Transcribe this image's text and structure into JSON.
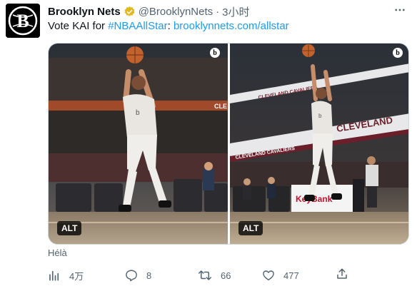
{
  "account": {
    "avatar_letter": "B",
    "display_name": "Brooklyn Nets",
    "handle": "@BrooklynNets",
    "separator": "·",
    "time": "3小时"
  },
  "tweet": {
    "text_prefix": "Vote KAI for ",
    "hashtag": "#NBAAllStar",
    "colon": ": ",
    "link": "brooklynnets.com/allstar"
  },
  "media": {
    "photos": [
      {
        "alt_label": "ALT",
        "logo": "b",
        "arena_sign": "CLE"
      },
      {
        "alt_label": "ALT",
        "logo": "b",
        "arena_sign_top": "CLEVELAND CAVALIERS",
        "arena_sign_mid": "CLEVELAND",
        "arena_sign_low": "CLEVELAND CAVALIERS",
        "sponsor": "KeyBank"
      }
    ]
  },
  "translate_label": "Hélà",
  "actions": {
    "views": "4万",
    "replies": "8",
    "retweets": "66",
    "likes": "477"
  },
  "colors": {
    "accent": "#1d9bf0",
    "muted": "#536471",
    "verified": "#e2b719"
  },
  "icons": {
    "verified": "verified-badge-icon",
    "more": "more-dots-icon",
    "views": "analytics-icon",
    "reply": "reply-icon",
    "retweet": "retweet-icon",
    "like": "heart-icon",
    "share": "share-icon"
  }
}
